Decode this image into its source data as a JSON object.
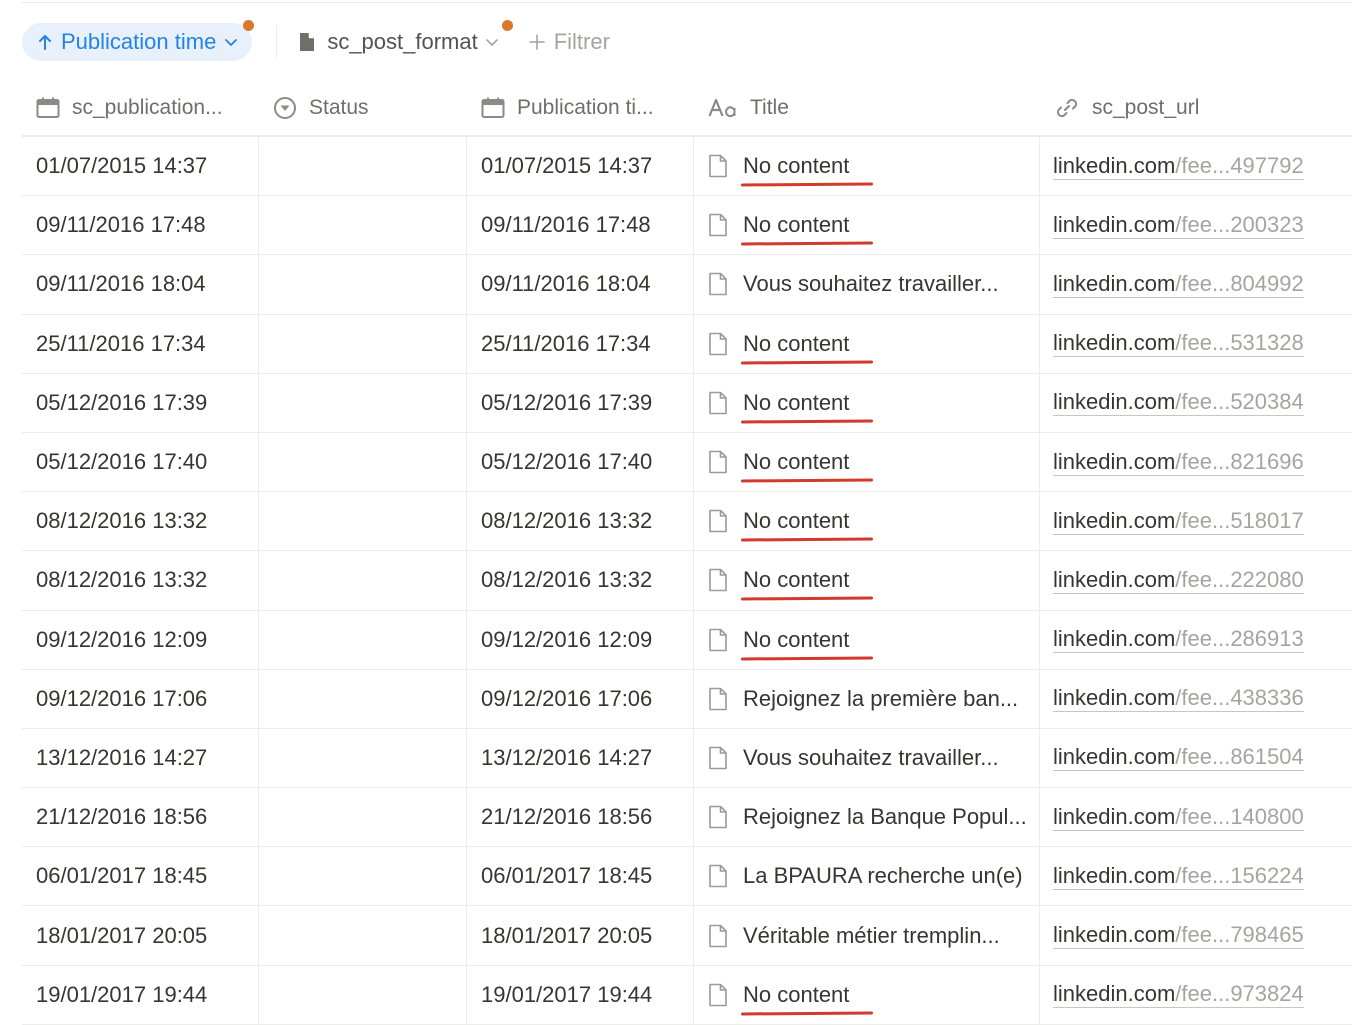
{
  "toolbar": {
    "sort_label": "Publication time",
    "format_label": "sc_post_format",
    "filter_label": "Filtrer"
  },
  "colors": {
    "accent": "#2383e2",
    "indicator_dot": "#d9792c",
    "annotation_underline": "#d23b2a"
  },
  "columns": [
    {
      "label": "sc_publication...",
      "icon": "calendar-icon"
    },
    {
      "label": "Status",
      "icon": "status-icon"
    },
    {
      "label": "Publication ti...",
      "icon": "calendar-icon"
    },
    {
      "label": "Title",
      "icon": "text-aa-icon"
    },
    {
      "label": "sc_post_url",
      "icon": "link-icon"
    }
  ],
  "rows": [
    {
      "sc_publication": "01/07/2015 14:37",
      "status": "",
      "publication_time": "01/07/2015 14:37",
      "title": "No content",
      "url_host": "linkedin.com",
      "url_rest": "/fee...497792"
    },
    {
      "sc_publication": "09/11/2016 17:48",
      "status": "",
      "publication_time": "09/11/2016 17:48",
      "title": "No content",
      "url_host": "linkedin.com",
      "url_rest": "/fee...200323"
    },
    {
      "sc_publication": "09/11/2016 18:04",
      "status": "",
      "publication_time": "09/11/2016 18:04",
      "title": "Vous souhaitez travailler...",
      "url_host": "linkedin.com",
      "url_rest": "/fee...804992"
    },
    {
      "sc_publication": "25/11/2016 17:34",
      "status": "",
      "publication_time": "25/11/2016 17:34",
      "title": "No content",
      "url_host": "linkedin.com",
      "url_rest": "/fee...531328"
    },
    {
      "sc_publication": "05/12/2016 17:39",
      "status": "",
      "publication_time": "05/12/2016 17:39",
      "title": "No content",
      "url_host": "linkedin.com",
      "url_rest": "/fee...520384"
    },
    {
      "sc_publication": "05/12/2016 17:40",
      "status": "",
      "publication_time": "05/12/2016 17:40",
      "title": "No content",
      "url_host": "linkedin.com",
      "url_rest": "/fee...821696"
    },
    {
      "sc_publication": "08/12/2016 13:32",
      "status": "",
      "publication_time": "08/12/2016 13:32",
      "title": "No content",
      "url_host": "linkedin.com",
      "url_rest": "/fee...518017"
    },
    {
      "sc_publication": "08/12/2016 13:32",
      "status": "",
      "publication_time": "08/12/2016 13:32",
      "title": "No content",
      "url_host": "linkedin.com",
      "url_rest": "/fee...222080"
    },
    {
      "sc_publication": "09/12/2016 12:09",
      "status": "",
      "publication_time": "09/12/2016 12:09",
      "title": "No content",
      "url_host": "linkedin.com",
      "url_rest": "/fee...286913"
    },
    {
      "sc_publication": "09/12/2016 17:06",
      "status": "",
      "publication_time": "09/12/2016 17:06",
      "title": "Rejoignez la première ban...",
      "url_host": "linkedin.com",
      "url_rest": "/fee...438336"
    },
    {
      "sc_publication": "13/12/2016 14:27",
      "status": "",
      "publication_time": "13/12/2016 14:27",
      "title": "Vous souhaitez travailler...",
      "url_host": "linkedin.com",
      "url_rest": "/fee...861504"
    },
    {
      "sc_publication": "21/12/2016 18:56",
      "status": "",
      "publication_time": "21/12/2016 18:56",
      "title": "Rejoignez la Banque Popul...",
      "url_host": "linkedin.com",
      "url_rest": "/fee...140800"
    },
    {
      "sc_publication": "06/01/2017 18:45",
      "status": "",
      "publication_time": "06/01/2017 18:45",
      "title": "La BPAURA recherche un(e)",
      "url_host": "linkedin.com",
      "url_rest": "/fee...156224"
    },
    {
      "sc_publication": "18/01/2017 20:05",
      "status": "",
      "publication_time": "18/01/2017 20:05",
      "title": "Véritable métier tremplin...",
      "url_host": "linkedin.com",
      "url_rest": "/fee...798465"
    },
    {
      "sc_publication": "19/01/2017 19:44",
      "status": "",
      "publication_time": "19/01/2017 19:44",
      "title": "No content",
      "url_host": "linkedin.com",
      "url_rest": "/fee...973824"
    }
  ]
}
